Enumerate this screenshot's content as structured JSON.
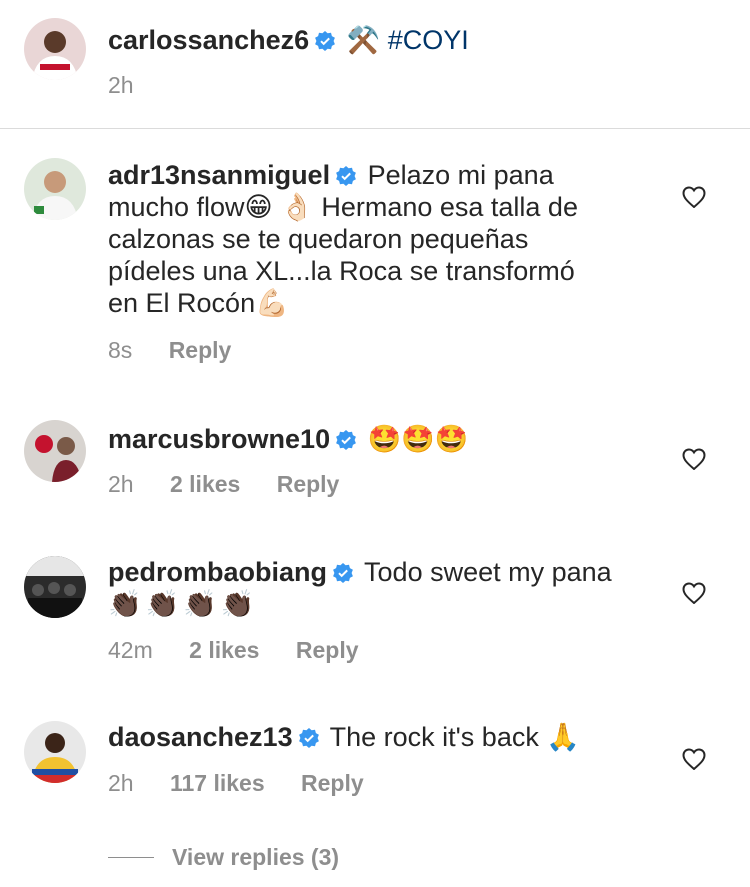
{
  "caption": {
    "username": "carlossanchez6",
    "text": "#COYI",
    "emoji": "⚒️",
    "time": "2h"
  },
  "comments": [
    {
      "username": "adr13nsanmiguel",
      "lines": [
        "Pelazo mi pana",
        "mucho flow😁 👌🏻 Hermano esa talla de",
        "calzonas se te quedaron pequeñas",
        "pídeles una XL...la Roca se transformó",
        "en El Rocón💪🏻"
      ],
      "time": "8s",
      "likes": "",
      "reply": "Reply"
    },
    {
      "username": "marcusbrowne10",
      "lines": [
        "🤩🤩🤩"
      ],
      "time": "2h",
      "likes": "2 likes",
      "reply": "Reply"
    },
    {
      "username": "pedrombaobiang",
      "lines": [
        "Todo sweet my pana",
        "👏🏿👏🏿👏🏿👏🏿"
      ],
      "time": "42m",
      "likes": "2 likes",
      "reply": "Reply"
    },
    {
      "username": "daosanchez13",
      "lines": [
        "The rock it's back 🙏"
      ],
      "time": "2h",
      "likes": "117 likes",
      "reply": "Reply"
    }
  ],
  "view_replies": "View replies (3)",
  "colors": {
    "verified": "#3897f0",
    "hashtag": "#003569",
    "muted": "#8e8e8e"
  }
}
